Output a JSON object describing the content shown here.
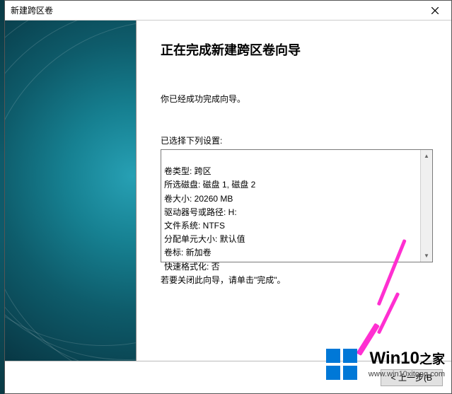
{
  "titlebar": {
    "text": "新建跨区卷"
  },
  "heading": "正在完成新建跨区卷向导",
  "success_msg": "你已经成功完成向导。",
  "settings_caption": "已选择下列设置:",
  "settings_lines": [
    "卷类型: 跨区",
    "所选磁盘: 磁盘 1, 磁盘 2",
    "卷大小: 20260 MB",
    "驱动器号或路径: H:",
    "文件系统: NTFS",
    "分配单元大小: 默认值",
    "卷标: 新加卷",
    "快速格式化: 否"
  ],
  "footnote": "若要关闭此向导，请单击\"完成\"。",
  "buttons": {
    "back": "< 上一步(B"
  },
  "watermark": {
    "brand_top": "Win10",
    "brand_sub": "www.win10xitong.com"
  }
}
